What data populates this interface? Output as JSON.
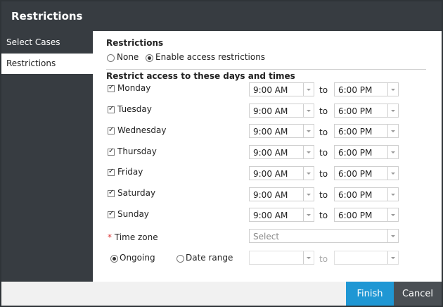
{
  "window": {
    "title": "Restrictions"
  },
  "sidebar": {
    "items": [
      {
        "label": "Select Cases",
        "active": false
      },
      {
        "label": "Restrictions",
        "active": true
      }
    ]
  },
  "restrictions": {
    "heading": "Restrictions",
    "none_label": "None",
    "enable_label": "Enable access restrictions",
    "selected": "enable"
  },
  "schedule": {
    "heading": "Restrict access to these days and times",
    "to_label": "to",
    "days": [
      {
        "name": "Monday",
        "checked": true,
        "start": "9:00 AM",
        "end": "6:00 PM"
      },
      {
        "name": "Tuesday",
        "checked": true,
        "start": "9:00 AM",
        "end": "6:00 PM"
      },
      {
        "name": "Wednesday",
        "checked": true,
        "start": "9:00 AM",
        "end": "6:00 PM"
      },
      {
        "name": "Thursday",
        "checked": true,
        "start": "9:00 AM",
        "end": "6:00 PM"
      },
      {
        "name": "Friday",
        "checked": true,
        "start": "9:00 AM",
        "end": "6:00 PM"
      },
      {
        "name": "Saturday",
        "checked": true,
        "start": "9:00 AM",
        "end": "6:00 PM"
      },
      {
        "name": "Sunday",
        "checked": true,
        "start": "9:00 AM",
        "end": "6:00 PM"
      }
    ]
  },
  "timezone": {
    "required_mark": "*",
    "label": "Time zone",
    "placeholder": "Select"
  },
  "period": {
    "ongoing_label": "Ongoing",
    "range_label": "Date range",
    "selected": "ongoing",
    "to_label": "to"
  },
  "footer": {
    "finish_label": "Finish",
    "cancel_label": "Cancel"
  },
  "colors": {
    "titlebar": "#373c41",
    "finish": "#1f97d4",
    "cancel": "#4a4f54"
  }
}
